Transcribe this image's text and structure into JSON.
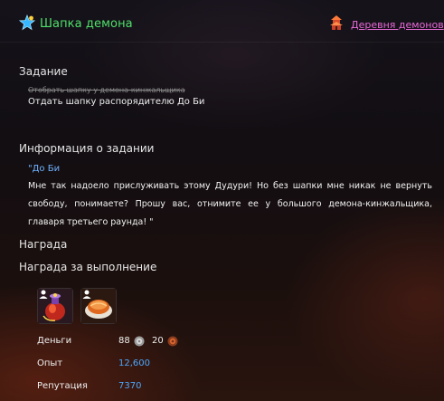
{
  "header": {
    "quest_icon": "star-quest-icon",
    "title": "Шапка демона",
    "location_icon": "pagoda-icon",
    "location_link": "Деревня демонов"
  },
  "task": {
    "heading": "Задание",
    "completed_step": "Отобрать шапку у демона-кинжальщика",
    "current_step": "Отдать шапку распорядителю До Би"
  },
  "info": {
    "heading": "Информация о задании",
    "speaker": "\"До Би",
    "text": "Мне так надоело прислуживать этому Дудури! Но без шапки мне никак не вернуть свободу, понимаете? Прошу вас, отнимите ее у большого демона-кинжальщика, главаря третьего раунда! \""
  },
  "reward": {
    "heading": "Награда",
    "subheading": "Награда за выполнение",
    "items": [
      {
        "name": "potion-item-icon"
      },
      {
        "name": "dumpling-item-icon"
      }
    ],
    "money_label": "Деньги",
    "silver": "88",
    "copper": "20",
    "exp_label": "Опыт",
    "exp": "12,600",
    "rep_label": "Репутация",
    "rep": "7370"
  },
  "colors": {
    "title": "#4fe06a",
    "link": "#e86ad8",
    "speaker": "#6fb3ff",
    "value": "#4aa8ff"
  }
}
